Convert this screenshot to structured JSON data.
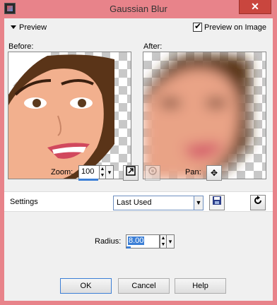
{
  "window": {
    "title": "Gaussian Blur",
    "close_glyph": "✕"
  },
  "preview": {
    "section_label": "Preview",
    "preview_on_image_label": "Preview on Image",
    "preview_on_image_checked": true
  },
  "panels": {
    "before_label": "Before:",
    "after_label": "After:"
  },
  "zoom": {
    "label": "Zoom:",
    "value": "100"
  },
  "pan": {
    "label": "Pan:"
  },
  "settings": {
    "label": "Settings",
    "selected": "Last Used"
  },
  "radius": {
    "label": "Radius:",
    "value": "8.00"
  },
  "buttons": {
    "ok": "OK",
    "cancel": "Cancel",
    "help": "Help"
  },
  "icons": {
    "zoom_fit": "zoom-to-fit-icon",
    "zoom_proof": "proof-preview-icon",
    "pan": "pan-move-icon",
    "save": "save-preset-icon",
    "reset": "reset-icon"
  }
}
